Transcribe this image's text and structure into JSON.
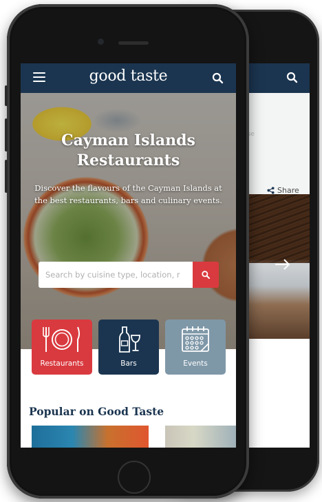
{
  "front": {
    "header": {
      "logo": "good taste",
      "menu_icon": "hamburger-icon",
      "search_icon": "search-icon"
    },
    "hero": {
      "title_line1": "Cayman Islands",
      "title_line2": "Restaurants",
      "subtitle": "Discover the flavours of the Cayman Islands at the best restaurants, bars and culinary events.",
      "search_placeholder": "Search by cuisine type, location, r"
    },
    "categories": [
      {
        "label": "Restaurants",
        "icon": "plate-cutlery-icon",
        "color": "#d93a3f"
      },
      {
        "label": "Bars",
        "icon": "wine-bottle-glass-icon",
        "color": "#1b3550"
      },
      {
        "label": "Events",
        "icon": "calendar-icon",
        "color": "#7f98a8"
      }
    ],
    "popular": {
      "heading": "Popular on Good Taste"
    }
  },
  "back": {
    "faded_text": "nse",
    "share_label": "Share",
    "share_icon": "share-icon",
    "arrow_icon": "arrow-right-icon"
  },
  "colors": {
    "navy": "#1b3550",
    "red": "#d93a3f",
    "slate": "#7f98a8"
  }
}
